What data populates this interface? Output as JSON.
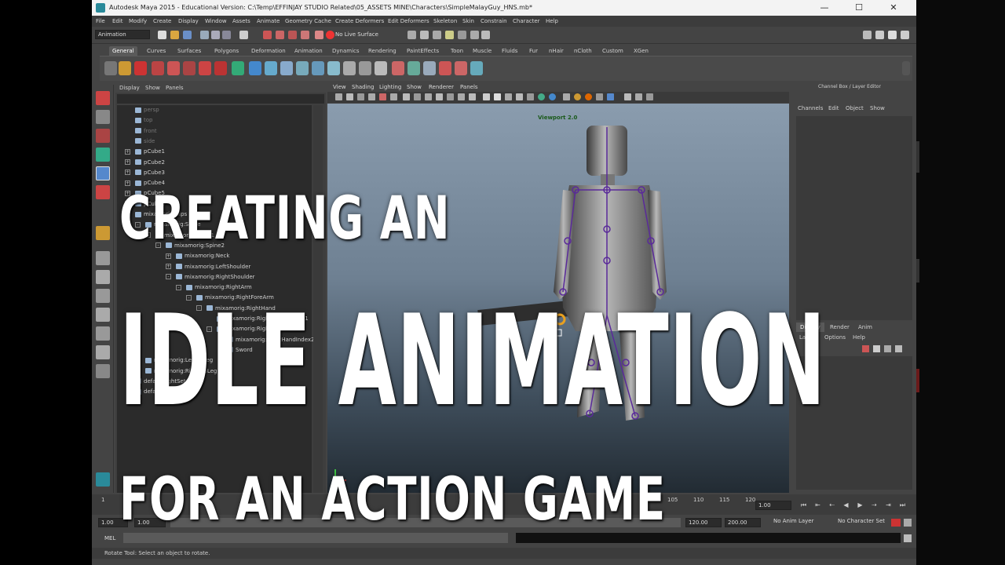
{
  "window": {
    "title": "Autodesk Maya 2015 - Educational Version: C:\\Temp\\EFFINJAY STUDIO Related\\05_ASSETS MINE\\Characters\\SimpleMalayGuy_HNS.mb*",
    "controls": [
      "—",
      "☐",
      "✕"
    ]
  },
  "menu": [
    "File",
    "Edit",
    "Modify",
    "Create",
    "Display",
    "Window",
    "Assets",
    "Animate",
    "Geometry Cache",
    "Create Deformers",
    "Edit Deformers",
    "Skeleton",
    "Skin",
    "Constrain",
    "Character",
    "Help"
  ],
  "status_line": {
    "mode": "Animation",
    "live_surface": "No Live Surface"
  },
  "shelf": {
    "tabs": [
      "General",
      "Curves",
      "Surfaces",
      "Polygons",
      "Deformation",
      "Animation",
      "Dynamics",
      "Rendering",
      "PaintEffects",
      "Toon",
      "Muscle",
      "Fluids",
      "Fur",
      "nHair",
      "nCloth",
      "Custom",
      "XGen"
    ],
    "active_tab": "General"
  },
  "outliner": {
    "menu": [
      "Display",
      "Show",
      "Panels"
    ],
    "rows": [
      {
        "label": "persp",
        "indent": 0,
        "dim": true,
        "exp": ""
      },
      {
        "label": "top",
        "indent": 0,
        "dim": true,
        "exp": ""
      },
      {
        "label": "front",
        "indent": 0,
        "dim": true,
        "exp": ""
      },
      {
        "label": "side",
        "indent": 0,
        "dim": true,
        "exp": ""
      },
      {
        "label": "pCube1",
        "indent": 0,
        "dim": false,
        "exp": "+"
      },
      {
        "label": "pCube2",
        "indent": 0,
        "dim": false,
        "exp": "+"
      },
      {
        "label": "pCube3",
        "indent": 0,
        "dim": false,
        "exp": "+"
      },
      {
        "label": "pCube4",
        "indent": 0,
        "dim": false,
        "exp": "+"
      },
      {
        "label": "pCube5",
        "indent": 0,
        "dim": false,
        "exp": "+"
      },
      {
        "label": "pCube6",
        "indent": 0,
        "dim": false,
        "exp": "+"
      },
      {
        "label": "mixamorig:Hips",
        "indent": 0,
        "dim": false,
        "exp": "-"
      },
      {
        "label": "mixamorig:Spine",
        "indent": 1,
        "dim": false,
        "exp": "-"
      },
      {
        "label": "mixamorig:Spine1",
        "indent": 2,
        "dim": false,
        "exp": "-"
      },
      {
        "label": "mixamorig:Spine2",
        "indent": 3,
        "dim": false,
        "exp": "-"
      },
      {
        "label": "mixamorig:Neck",
        "indent": 4,
        "dim": false,
        "exp": "+"
      },
      {
        "label": "mixamorig:LeftShoulder",
        "indent": 4,
        "dim": false,
        "exp": "+"
      },
      {
        "label": "mixamorig:RightShoulder",
        "indent": 4,
        "dim": false,
        "exp": "-"
      },
      {
        "label": "mixamorig:RightArm",
        "indent": 5,
        "dim": false,
        "exp": "-"
      },
      {
        "label": "mixamorig:RightForeArm",
        "indent": 6,
        "dim": false,
        "exp": "-"
      },
      {
        "label": "mixamorig:RightHand",
        "indent": 7,
        "dim": false,
        "exp": "-"
      },
      {
        "label": "mixamorig:RightHandThumb1",
        "indent": 8,
        "dim": false,
        "exp": ""
      },
      {
        "label": "mixamorig:RightHandIndex1",
        "indent": 8,
        "dim": false,
        "exp": "-"
      },
      {
        "label": "mixamorig:RightHandIndex2",
        "indent": 9,
        "dim": false,
        "exp": ""
      },
      {
        "label": "Sword",
        "indent": 9,
        "dim": false,
        "exp": ""
      },
      {
        "label": "mixamorig:LeftUpLeg",
        "indent": 1,
        "dim": false,
        "exp": "+"
      },
      {
        "label": "mixamorig:RightUpLeg",
        "indent": 1,
        "dim": false,
        "exp": "+"
      },
      {
        "label": "defaultLightSet",
        "indent": 0,
        "dim": false,
        "exp": ""
      },
      {
        "label": "defaultObjectSet",
        "indent": 0,
        "dim": false,
        "exp": ""
      }
    ]
  },
  "viewport": {
    "menu": [
      "View",
      "Shading",
      "Lighting",
      "Show",
      "Renderer",
      "Panels"
    ],
    "label": "Viewport 2.0"
  },
  "channel_box": {
    "title": "Channel Box / Layer Editor",
    "menu": [
      "Channels",
      "Edit",
      "Object",
      "Show"
    ],
    "layer_tabs": [
      "Display",
      "Render",
      "Anim"
    ],
    "active_layer_tab": "Display",
    "layer_menu": [
      "Layers",
      "Options",
      "Help"
    ]
  },
  "time_slider": {
    "ticks": [
      "1",
      "105",
      "110",
      "115",
      "120"
    ],
    "current_frame": "1.00"
  },
  "range_slider": {
    "start_time": "1.00",
    "playback_start": "1.00",
    "playback_end": "120.00",
    "end_time": "200.00",
    "anim_layer": "No Anim Layer",
    "character_set": "No Character Set"
  },
  "command_line": {
    "label": "MEL"
  },
  "help_line": "Rotate Tool: Select an object to rotate.",
  "overlay": {
    "line1": "CREATING AN",
    "line2": "IDLE ANIMATION",
    "line3": "FOR AN ACTION GAME"
  },
  "colors": {
    "overlay_text": "#ffffff",
    "ui_bg": "#444444",
    "viewport_sky": "#8a9cae"
  }
}
